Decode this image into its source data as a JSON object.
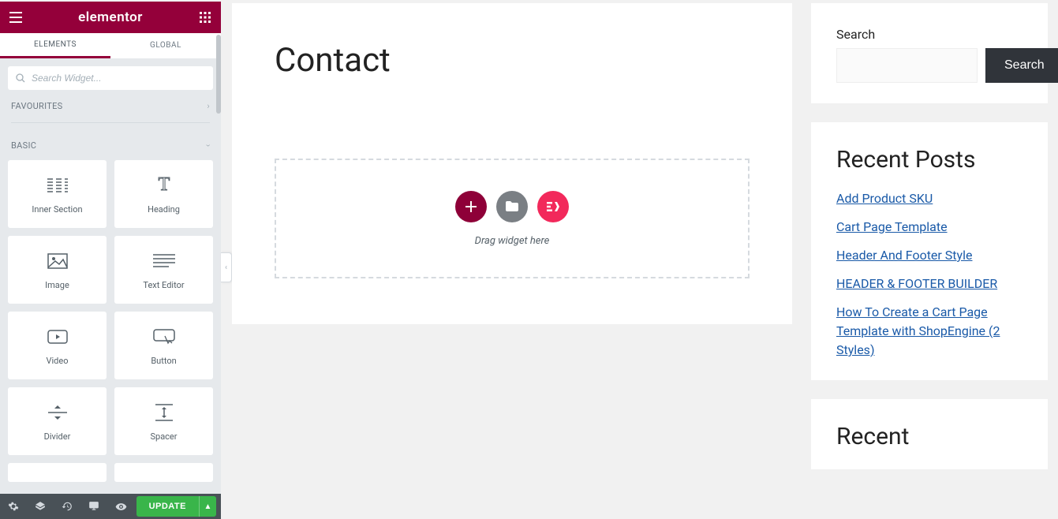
{
  "sidebar": {
    "brand": "elementor",
    "tabs": {
      "elements": "ELEMENTS",
      "global": "GLOBAL"
    },
    "search_placeholder": "Search Widget...",
    "categories": {
      "favourites": "FAVOURITES",
      "basic": "BASIC"
    },
    "widgets": [
      {
        "id": "inner-section",
        "label": "Inner Section"
      },
      {
        "id": "heading",
        "label": "Heading"
      },
      {
        "id": "image",
        "label": "Image"
      },
      {
        "id": "text-editor",
        "label": "Text Editor"
      },
      {
        "id": "video",
        "label": "Video"
      },
      {
        "id": "button",
        "label": "Button"
      },
      {
        "id": "divider",
        "label": "Divider"
      },
      {
        "id": "spacer",
        "label": "Spacer"
      }
    ]
  },
  "bottombar": {
    "publish_label": "UPDATE"
  },
  "page": {
    "title": "Contact",
    "dropzone_text": "Drag widget here"
  },
  "right": {
    "search": {
      "label": "Search",
      "button": "Search"
    },
    "recent_posts": {
      "heading": "Recent Posts",
      "items": [
        "Add Product SKU",
        "Cart Page Template",
        "Header And Footer Style",
        "HEADER & FOOTER BUILDER",
        "How To Create a Cart Page Template with ShopEngine (2 Styles)"
      ]
    },
    "recent2": {
      "heading": "Recent"
    }
  }
}
